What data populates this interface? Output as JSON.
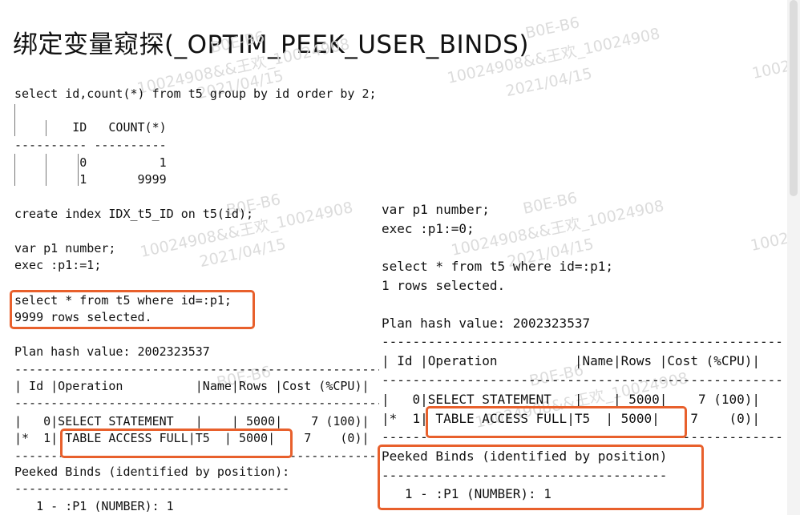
{
  "title": "绑定变量窥探(_OPTIM_PEEK_USER_BINDS)",
  "watermark": {
    "id_text": "B0E-B6",
    "user_text": "10024908&&王欢_10024908",
    "date_text": "2021/04/15",
    "number_text": "10024"
  },
  "left": {
    "query1": "select id,count(*) from t5 group by id order by 2;",
    "result_header": "        ID   COUNT(*)",
    "result_rule": "---------- ----------",
    "result_row1": "         0          1",
    "result_row2": "         1       9999",
    "create_index": "create index IDX_t5_ID on t5(id);",
    "var_decl": "var p1 number;",
    "exec_bind": "exec :p1:=1;",
    "select_bind": "select * from t5 where id=:p1;",
    "rows_selected": "9999 rows selected.",
    "plan_hash": "Plan hash value: 2002323537",
    "plan_rule": "-------------------------------------------------------",
    "plan_header": "| Id |Operation          |Name|Rows |Cost (%CPU)|",
    "plan_row0": "|   0|SELECT STATEMENT   |    | 5000|    7 (100)|",
    "plan_row1": "|*  1| TABLE ACCESS FULL|T5  | 5000|    7    (0)|",
    "peeked_title": "Peeked Binds (identified by position):",
    "peeked_rule": "--------------------------------------",
    "peeked_value": "   1 - :P1 (NUMBER): 1"
  },
  "right": {
    "var_decl": "var p1 number;",
    "exec_bind": "exec :p1:=0;",
    "select_bind": "select * from t5 where id=:p1;",
    "rows_selected": "1 rows selected.",
    "plan_hash": "Plan hash value: 2002323537",
    "plan_rule": "----------------------------------------------------",
    "plan_header": "| Id |Operation          |Name|Rows |Cost (%CPU)|",
    "plan_row0": "|   0|SELECT STATEMENT   |    | 5000|    7 (100)|",
    "plan_row1": "|*  1| TABLE ACCESS FULL|T5  | 5000|    7    (0)|",
    "peeked_title": "Peeked Binds (identified by position)",
    "peeked_rule": "-------------------------------------",
    "peeked_value": "   1 - :P1 (NUMBER): 1"
  },
  "colors": {
    "highlight": "#e8602c",
    "watermark": "#d9d9d9",
    "text": "#111111"
  }
}
